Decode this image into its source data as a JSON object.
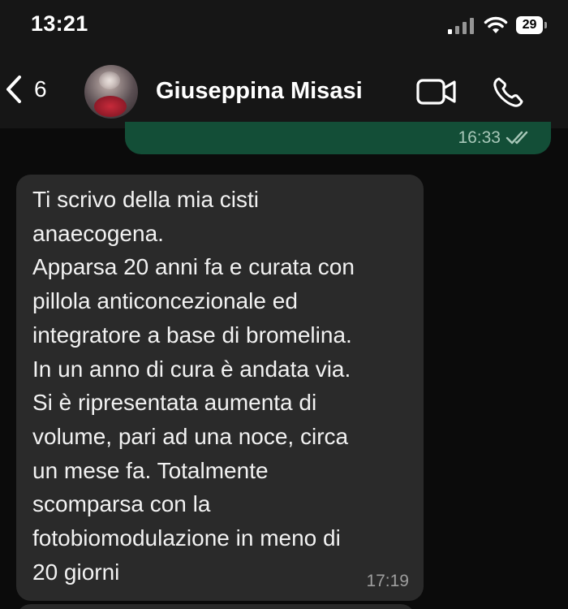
{
  "status_bar": {
    "time": "13:21",
    "battery": "29",
    "signal_icon": "cellular-signal-icon",
    "wifi_icon": "wifi-icon"
  },
  "header": {
    "back_icon": "chevron-left-icon",
    "unread_count": "6",
    "contact_name": "Giuseppina Misasi",
    "video_call_icon": "video-camera-icon",
    "voice_call_icon": "phone-icon"
  },
  "messages": [
    {
      "direction": "outgoing",
      "time": "16:33",
      "status_icon": "double-check-icon"
    },
    {
      "direction": "incoming",
      "lines": [
        "Ti scrivo della mia cisti",
        "anaecogena.",
        "Apparsa 20 anni fa e curata con",
        "pillola anticoncezionale ed",
        "integratore a base di bromelina.",
        "In un anno di cura è andata via.",
        "Si è ripresentata aumenta di",
        "volume, pari ad una noce, circa",
        "un mese fa. Totalmente",
        "scomparsa con la",
        "fotobiomodulazione in meno di",
        "20 giorni"
      ],
      "time": "17:19"
    }
  ],
  "colors": {
    "background": "#0b0b0b",
    "header_bg": "#161616",
    "outgoing_bubble": "#134e37",
    "incoming_bubble": "#2a2a2a"
  }
}
